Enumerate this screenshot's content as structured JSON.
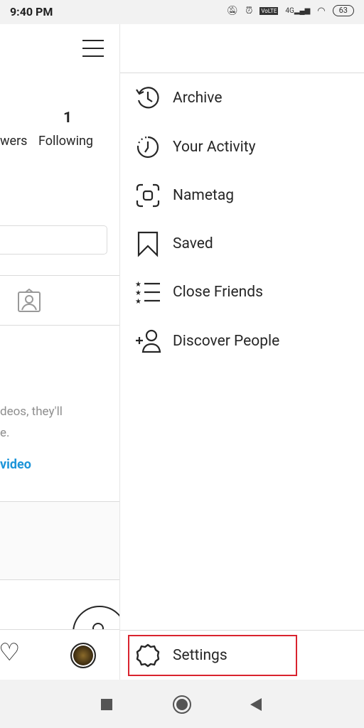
{
  "status_bar": {
    "time": "9:40 PM",
    "battery": "63",
    "network": "4G"
  },
  "profile": {
    "followers_label_partial": "wers",
    "following_count": "1",
    "following_label": "Following",
    "empty_text_line1": "deos, they'll",
    "empty_text_line2": "e.",
    "link_partial": "video"
  },
  "drawer": {
    "items": [
      {
        "label": "Archive",
        "icon": "archive-icon"
      },
      {
        "label": "Your Activity",
        "icon": "activity-icon"
      },
      {
        "label": "Nametag",
        "icon": "nametag-icon"
      },
      {
        "label": "Saved",
        "icon": "bookmark-icon"
      },
      {
        "label": "Close Friends",
        "icon": "close-friends-icon"
      },
      {
        "label": "Discover People",
        "icon": "add-person-icon"
      }
    ],
    "settings_label": "Settings",
    "highlight_color": "#d9232e"
  },
  "colors": {
    "link": "#1d95d9"
  }
}
